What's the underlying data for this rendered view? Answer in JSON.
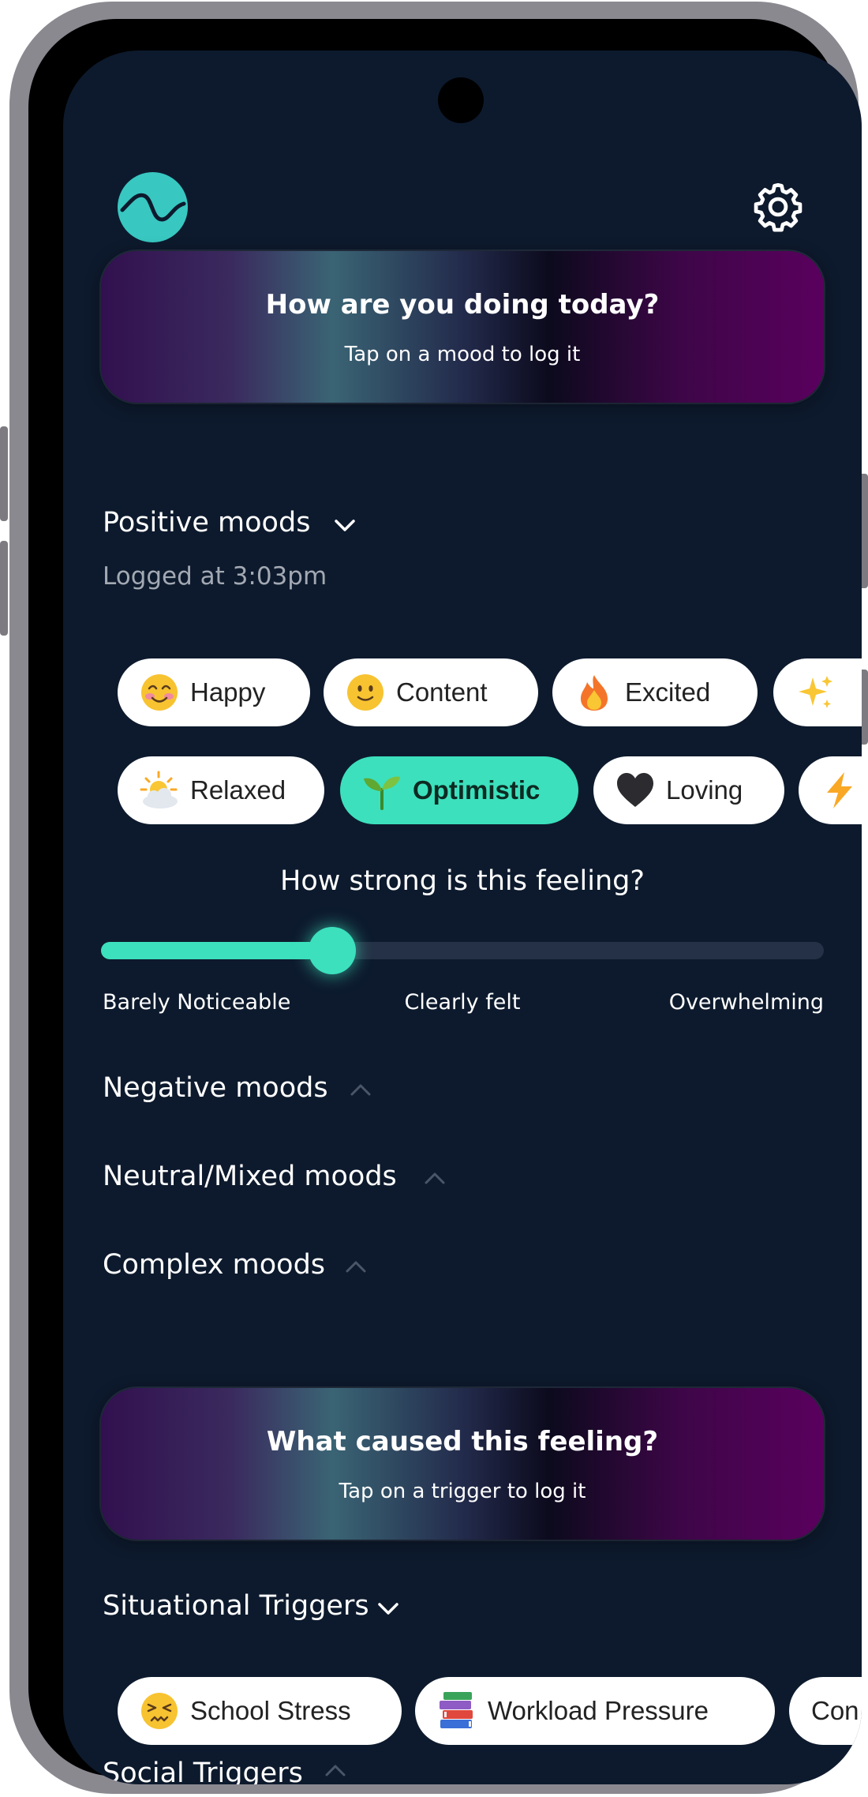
{
  "header": {
    "logo_icon": "wave-logo-icon",
    "settings_icon": "gear-icon"
  },
  "mood_banner": {
    "title": "How are you doing today?",
    "subtitle": "Tap on a mood to log it"
  },
  "positive_moods": {
    "title": "Positive moods",
    "logged": "Logged at 3:03pm",
    "chips_row1": [
      {
        "label": "Happy",
        "icon": "smiling-face-icon"
      },
      {
        "label": "Content",
        "icon": "slight-smile-icon"
      },
      {
        "label": "Excited",
        "icon": "fire-icon"
      },
      {
        "label": "",
        "icon": "sparkles-icon"
      }
    ],
    "chips_row2": [
      {
        "label": "Relaxed",
        "icon": "sun-behind-cloud-icon"
      },
      {
        "label": "Optimistic",
        "icon": "seedling-icon",
        "selected": true
      },
      {
        "label": "Loving",
        "icon": "black-heart-icon"
      },
      {
        "label": "",
        "icon": "lightning-icon"
      }
    ]
  },
  "intensity": {
    "question": "How strong is this feeling?",
    "value_fraction": 0.32,
    "labels": [
      "Barely Noticeable",
      "Clearly felt",
      "Overwhelming"
    ]
  },
  "collapsed_sections": [
    "Negative moods",
    "Neutral/Mixed moods",
    "Complex moods"
  ],
  "trigger_banner": {
    "title": "What caused this feeling?",
    "subtitle": "Tap on a trigger to log it"
  },
  "situational_triggers": {
    "title": "Situational Triggers",
    "chips": [
      {
        "label": "School Stress",
        "icon": "persevering-face-icon"
      },
      {
        "label": "Workload Pressure",
        "icon": "books-icon"
      },
      {
        "label": "Con",
        "icon": ""
      }
    ]
  },
  "social_triggers": {
    "title": "Social Triggers"
  },
  "colors": {
    "background": "#0d1a2d",
    "accent": "#3ce0bd",
    "logo": "#38c7c1"
  }
}
